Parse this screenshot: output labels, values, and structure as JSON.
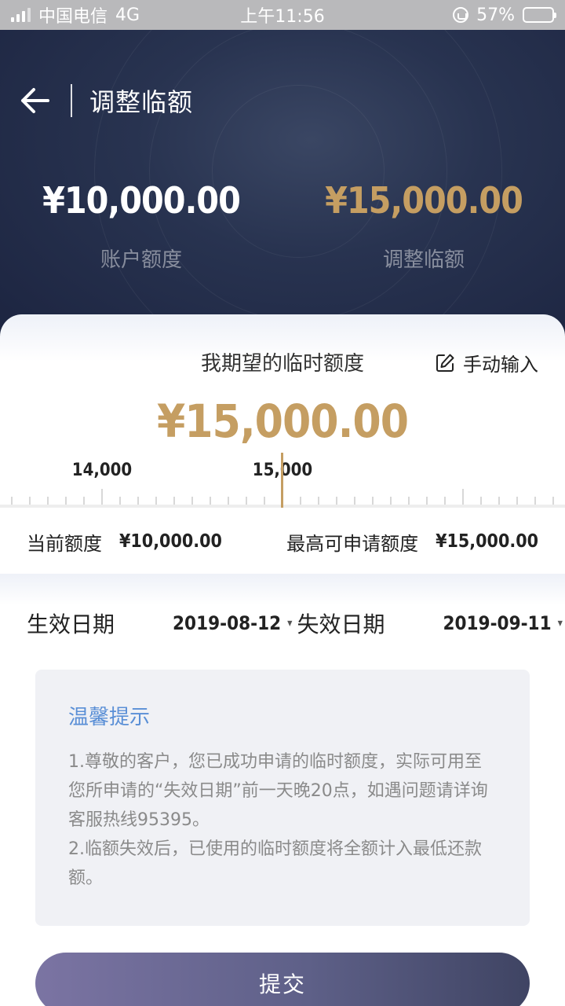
{
  "status_bar": {
    "carrier": "中国电信",
    "network": "4G",
    "time": "上午11:56",
    "battery": "57%",
    "battery_level": 0.57
  },
  "header": {
    "title": "调整临额"
  },
  "summary": {
    "account_limit_value": "¥10,000.00",
    "account_limit_label": "账户额度",
    "adjusted_limit_value": "¥15,000.00",
    "adjusted_limit_label": "调整临额"
  },
  "desired": {
    "label": "我期望的临时额度",
    "manual_input_label": "手动输入",
    "value": "¥15,000.00"
  },
  "ruler": {
    "left_label": "14,000",
    "center_label": "15,000",
    "selected_value": 15000
  },
  "limits": {
    "current_label": "当前额度",
    "current_value": "¥10,000.00",
    "max_label": "最高可申请额度",
    "max_value": "¥15,000.00"
  },
  "dates": {
    "effective_label": "生效日期",
    "effective_value": "2019-08-12",
    "expiry_label": "失效日期",
    "expiry_value": "2019-09-11"
  },
  "tips": {
    "title": "温馨提示",
    "line1": "1.尊敬的客户，您已成功申请的临时额度，实际可用至您所申请的“失效日期”前一天晚20点，如遇问题请详询客服热线95395。",
    "line2": "2.临额失效后，已使用的临时额度将全额计入最低还款额。"
  },
  "submit_label": "提交",
  "colors": {
    "gold": "#c59e62",
    "hero_bg": "#283350",
    "tips_title": "#5a8fd6"
  }
}
